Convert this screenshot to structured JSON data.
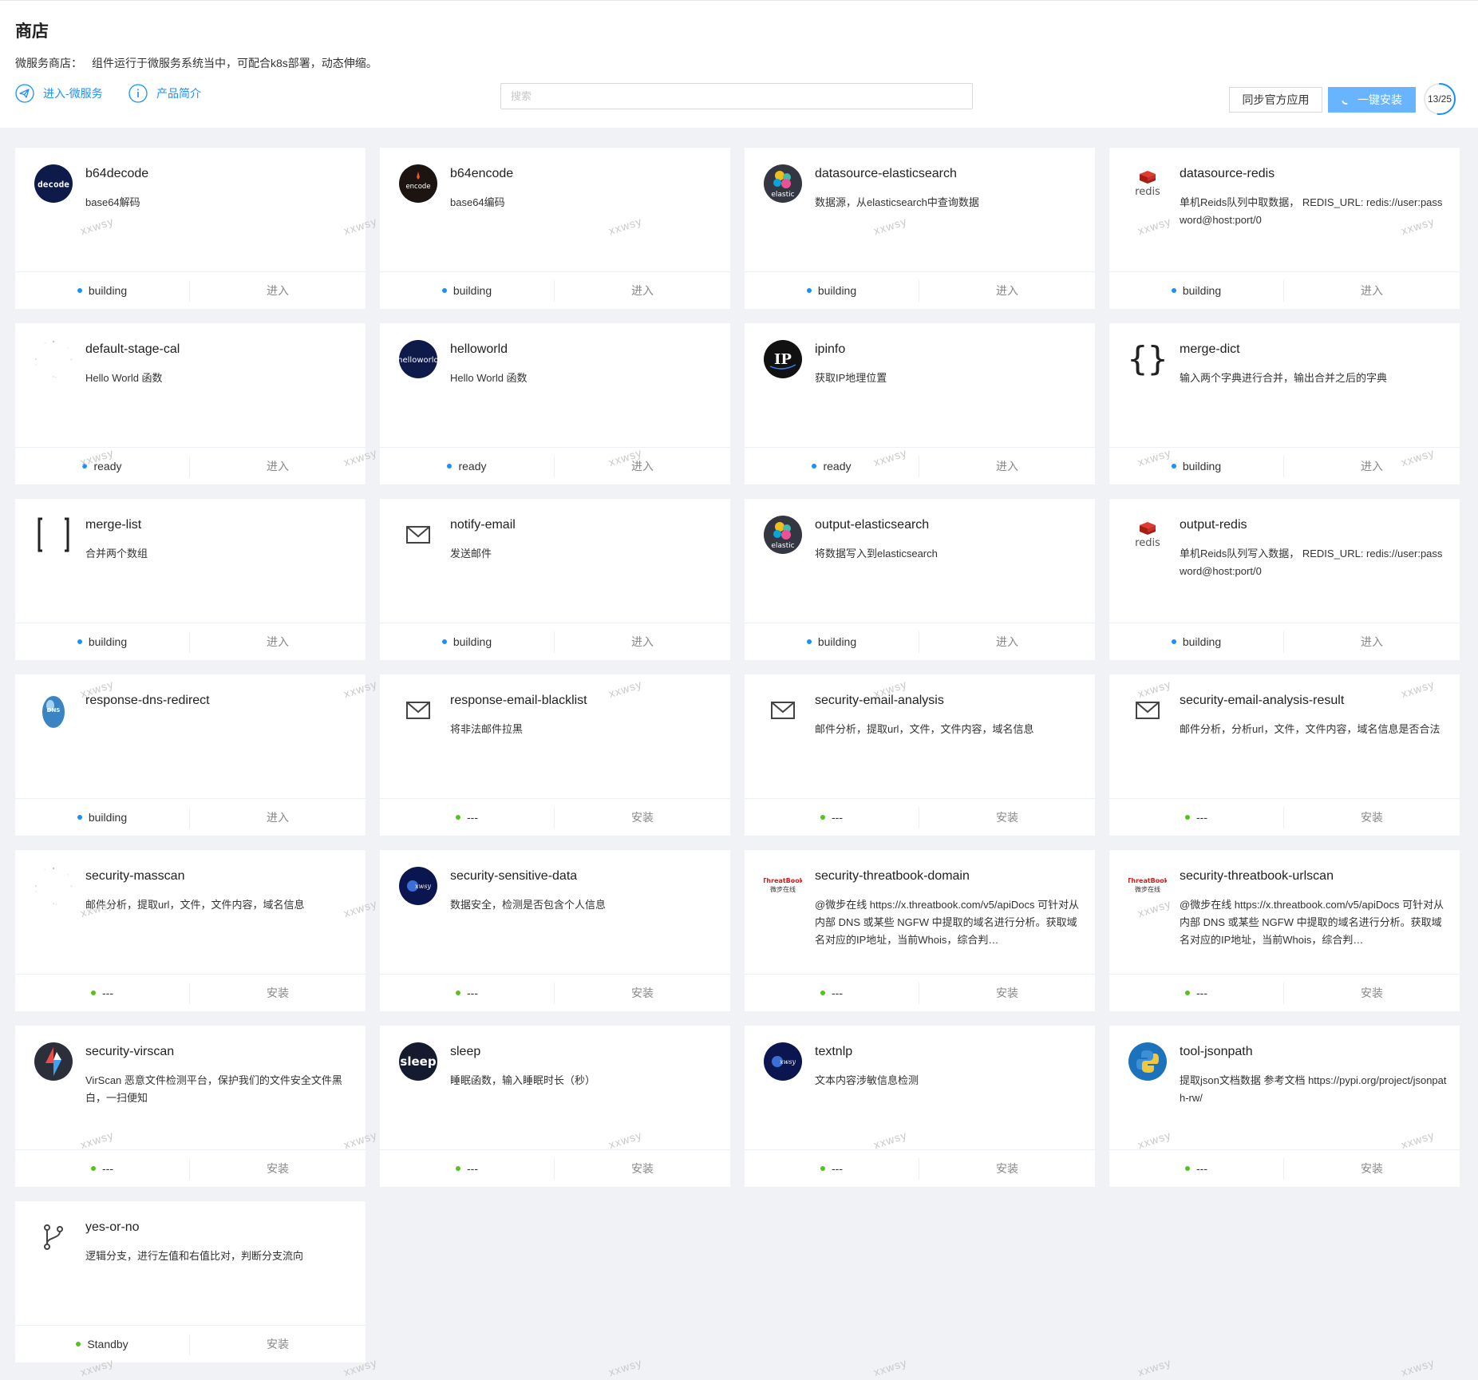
{
  "header": {
    "title": "商店",
    "desc_label": "微服务商店：",
    "desc_text": "组件运行于微服务系统当中，可配合k8s部署，动态伸缩。",
    "link_enter": "进入-微服务",
    "link_intro": "产品简介",
    "search_placeholder": "搜索",
    "sync_button": "同步官方应用",
    "install_button": "一键安装",
    "progress_text": "13/25",
    "progress_fraction": 0.52
  },
  "colors": {
    "accent": "#1890ff",
    "building": "#1890ff",
    "ready": "#1890ff",
    "idle": "#52c41a"
  },
  "watermark": "xxwsy",
  "cards": [
    {
      "title": "b64decode",
      "desc": "base64解码",
      "status": "building",
      "action": "进入",
      "icon": "decode-icon"
    },
    {
      "title": "b64encode",
      "desc": "base64编码",
      "status": "building",
      "action": "进入",
      "icon": "encode-icon"
    },
    {
      "title": "datasource-elasticsearch",
      "desc": "数据源，从elasticsearch中查询数据",
      "status": "building",
      "action": "进入",
      "icon": "elastic-icon"
    },
    {
      "title": "datasource-redis",
      "desc": "单机Reids队列中取数据， REDIS_URL: redis://user:password@host:port/0",
      "status": "building",
      "action": "进入",
      "icon": "redis-icon"
    },
    {
      "title": "default-stage-cal",
      "desc": "Hello World 函数",
      "status": "ready",
      "action": "进入",
      "icon": "loading-icon"
    },
    {
      "title": "helloworld",
      "desc": "Hello World 函数",
      "status": "ready",
      "action": "进入",
      "icon": "helloworld-icon"
    },
    {
      "title": "ipinfo",
      "desc": "获取IP地理位置",
      "status": "ready",
      "action": "进入",
      "icon": "ip-icon"
    },
    {
      "title": "merge-dict",
      "desc": "输入两个字典进行合并，输出合并之后的字典",
      "status": "building",
      "action": "进入",
      "icon": "braces-icon"
    },
    {
      "title": "merge-list",
      "desc": "合并两个数组",
      "status": "building",
      "action": "进入",
      "icon": "brackets-icon"
    },
    {
      "title": "notify-email",
      "desc": "发送邮件",
      "status": "building",
      "action": "进入",
      "icon": "mail-icon"
    },
    {
      "title": "output-elasticsearch",
      "desc": "将数据写入到elasticsearch",
      "status": "building",
      "action": "进入",
      "icon": "elastic-icon"
    },
    {
      "title": "output-redis",
      "desc": "单机Reids队列写入数据， REDIS_URL: redis://user:password@host:port/0",
      "status": "building",
      "action": "进入",
      "icon": "redis-icon"
    },
    {
      "title": "response-dns-redirect",
      "desc": "",
      "status": "building",
      "action": "进入",
      "icon": "dns-icon"
    },
    {
      "title": "response-email-blacklist",
      "desc": "将非法邮件拉黑",
      "status": "---",
      "action": "安装",
      "icon": "mail-icon"
    },
    {
      "title": "security-email-analysis",
      "desc": "邮件分析，提取url，文件，文件内容，域名信息",
      "status": "---",
      "action": "安装",
      "icon": "mail-icon"
    },
    {
      "title": "security-email-analysis-result",
      "desc": "邮件分析，分析url，文件，文件内容，域名信息是否合法",
      "status": "---",
      "action": "安装",
      "icon": "mail-icon"
    },
    {
      "title": "security-masscan",
      "desc": "邮件分析，提取url，文件，文件内容，域名信息",
      "status": "---",
      "action": "安装",
      "icon": "loading-icon"
    },
    {
      "title": "security-sensitive-data",
      "desc": "数据安全，检测是否包含个人信息",
      "status": "---",
      "action": "安装",
      "icon": "xwsy-icon"
    },
    {
      "title": "security-threatbook-domain",
      "desc": "@微步在线 https://x.threatbook.com/v5/apiDocs 可针对从内部 DNS 或某些 NGFW 中提取的域名进行分析。获取域名对应的IP地址，当前Whois，综合判…",
      "status": "---",
      "action": "安装",
      "icon": "threatbook-icon"
    },
    {
      "title": "security-threatbook-urlscan",
      "desc": "@微步在线 https://x.threatbook.com/v5/apiDocs 可针对从内部 DNS 或某些 NGFW 中提取的域名进行分析。获取域名对应的IP地址，当前Whois，综合判…",
      "status": "---",
      "action": "安装",
      "icon": "threatbook-icon"
    },
    {
      "title": "security-virscan",
      "desc": "VirScan 恶意文件检测平台，保护我们的文件安全文件黑白，一扫便知",
      "status": "---",
      "action": "安装",
      "icon": "virscan-icon"
    },
    {
      "title": "sleep",
      "desc": "睡眠函数，输入睡眠时长（秒）",
      "status": "---",
      "action": "安装",
      "icon": "sleep-icon"
    },
    {
      "title": "textnlp",
      "desc": "文本内容涉敏信息检测",
      "status": "---",
      "action": "安装",
      "icon": "xwsy-icon"
    },
    {
      "title": "tool-jsonpath",
      "desc": "提取json文档数据 参考文档 https://pypi.org/project/jsonpath-rw/",
      "status": "---",
      "action": "安装",
      "icon": "python-icon"
    },
    {
      "title": "yes-or-no",
      "desc": "逻辑分支，进行左值和右值比对，判断分支流向",
      "status": "Standby",
      "action": "安装",
      "icon": "branch-icon"
    }
  ]
}
